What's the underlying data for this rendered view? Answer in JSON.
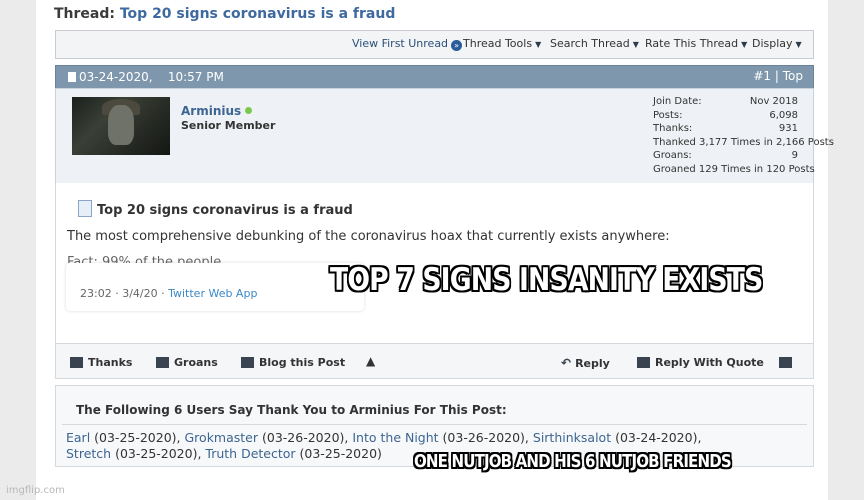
{
  "thread": {
    "prefix": "Thread:",
    "title": "Top 20 signs coronavirus is a fraud"
  },
  "toolbar": {
    "view_first_unread": "View First Unread",
    "thread_tools": "Thread Tools",
    "search_thread": "Search Thread",
    "rate_thread": "Rate This Thread",
    "display": "Display"
  },
  "post": {
    "date": "03-24-2020,",
    "time": "10:57 PM",
    "number": "#1",
    "top": "Top",
    "title": "Top 20 signs coronavirus is a fraud",
    "body_text": "The most comprehensive debunking of the coronavirus hoax that currently exists anywhere:",
    "embed_time": "23:02 · 3/4/20 · ",
    "embed_source": "Twitter Web App"
  },
  "user": {
    "name": "Arminius",
    "rank": "Senior Member",
    "stats": {
      "join_label": "Join Date:",
      "join_value": "Nov 2018",
      "posts_label": "Posts:",
      "posts_value": "6,098",
      "thanks_label": "Thanks:",
      "thanks_value": "931",
      "thanked": "Thanked 3,177 Times in 2,166 Posts",
      "groans_label": "Groans:",
      "groans_value": "9",
      "groaned": "Groaned 129 Times in 120 Posts"
    }
  },
  "actions": {
    "thanks": "Thanks",
    "groans": "Groans",
    "blog": "Blog this Post",
    "reply": "Reply",
    "reply_quote": "Reply With Quote"
  },
  "thanks_box": {
    "heading": "The Following 6 Users Say Thank You to Arminius For This Post:",
    "users": [
      {
        "name": "Earl",
        "date": " (03-25-2020), "
      },
      {
        "name": "Grokmaster",
        "date": " (03-26-2020), "
      },
      {
        "name": "Into the Night",
        "date": " (03-26-2020), "
      },
      {
        "name": "Sirthinksalot",
        "date": " (03-24-2020),"
      },
      {
        "name": "Stretch",
        "date": " (03-25-2020), "
      },
      {
        "name": "Truth Detector",
        "date": " (03-25-2020)"
      }
    ]
  },
  "meme": {
    "top_caption": "TOP 7 SIGNS INSANITY EXISTS",
    "bottom_caption": "ONE NUTJOB AND HIS 6 NUTJOB FRIENDS"
  },
  "watermark": "imgflip.com"
}
